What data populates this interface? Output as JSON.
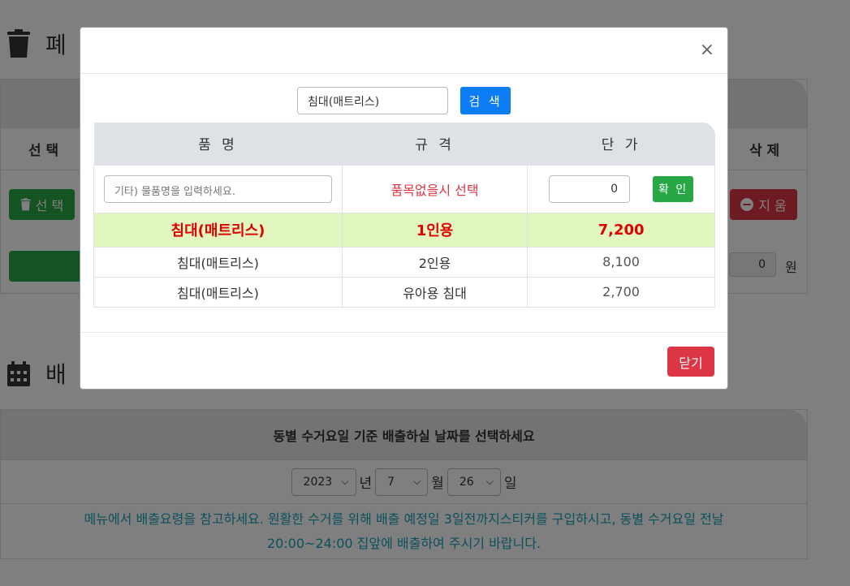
{
  "background": {
    "section1_title": "폐",
    "section2_title": "배",
    "col_select": "선 택",
    "col_delete": "삭 제",
    "btn_select": "선 택",
    "btn_clear": "지 움",
    "total_value": "0",
    "total_unit": "원",
    "date_header": "동별 수거요일 기준 배출하실 날짜를 선택하세요",
    "year": "2023",
    "year_unit": "년",
    "month": "7",
    "month_unit": "월",
    "day": "26",
    "day_unit": "일",
    "notice_line1": "메뉴에서 배출요령을 참고하세요. 원활한 수거를 위해 배출 예정일 3일전까지스티커를 구입하시고, 동별 수거요일 전날",
    "notice_line2": "20:00~24:00 집앞에 배출하여 주시기 바랍니다."
  },
  "modal": {
    "close_symbol": "×",
    "search_value": "침대(매트리스)",
    "search_button": "검 색",
    "headers": [
      "품 명",
      "규 격",
      "단 가"
    ],
    "etc_placeholder": "기타) 물품명을 입력하세요.",
    "no_item_text": "품목없을시 선택",
    "price_value": "0",
    "confirm_button": "확 인",
    "rows": [
      {
        "name": "침대(매트리스)",
        "spec": "1인용",
        "price": "7,200",
        "highlighted": true
      },
      {
        "name": "침대(매트리스)",
        "spec": "2인용",
        "price": "8,100",
        "highlighted": false
      },
      {
        "name": "침대(매트리스)",
        "spec": "유아용 침대",
        "price": "2,700",
        "highlighted": false
      }
    ],
    "close_button": "닫기"
  },
  "colors": {
    "primary": "#0d7df5",
    "success": "#28a745",
    "danger": "#dc3545",
    "highlight_row": "#e2f6c0",
    "info_text": "#17a2b8"
  }
}
